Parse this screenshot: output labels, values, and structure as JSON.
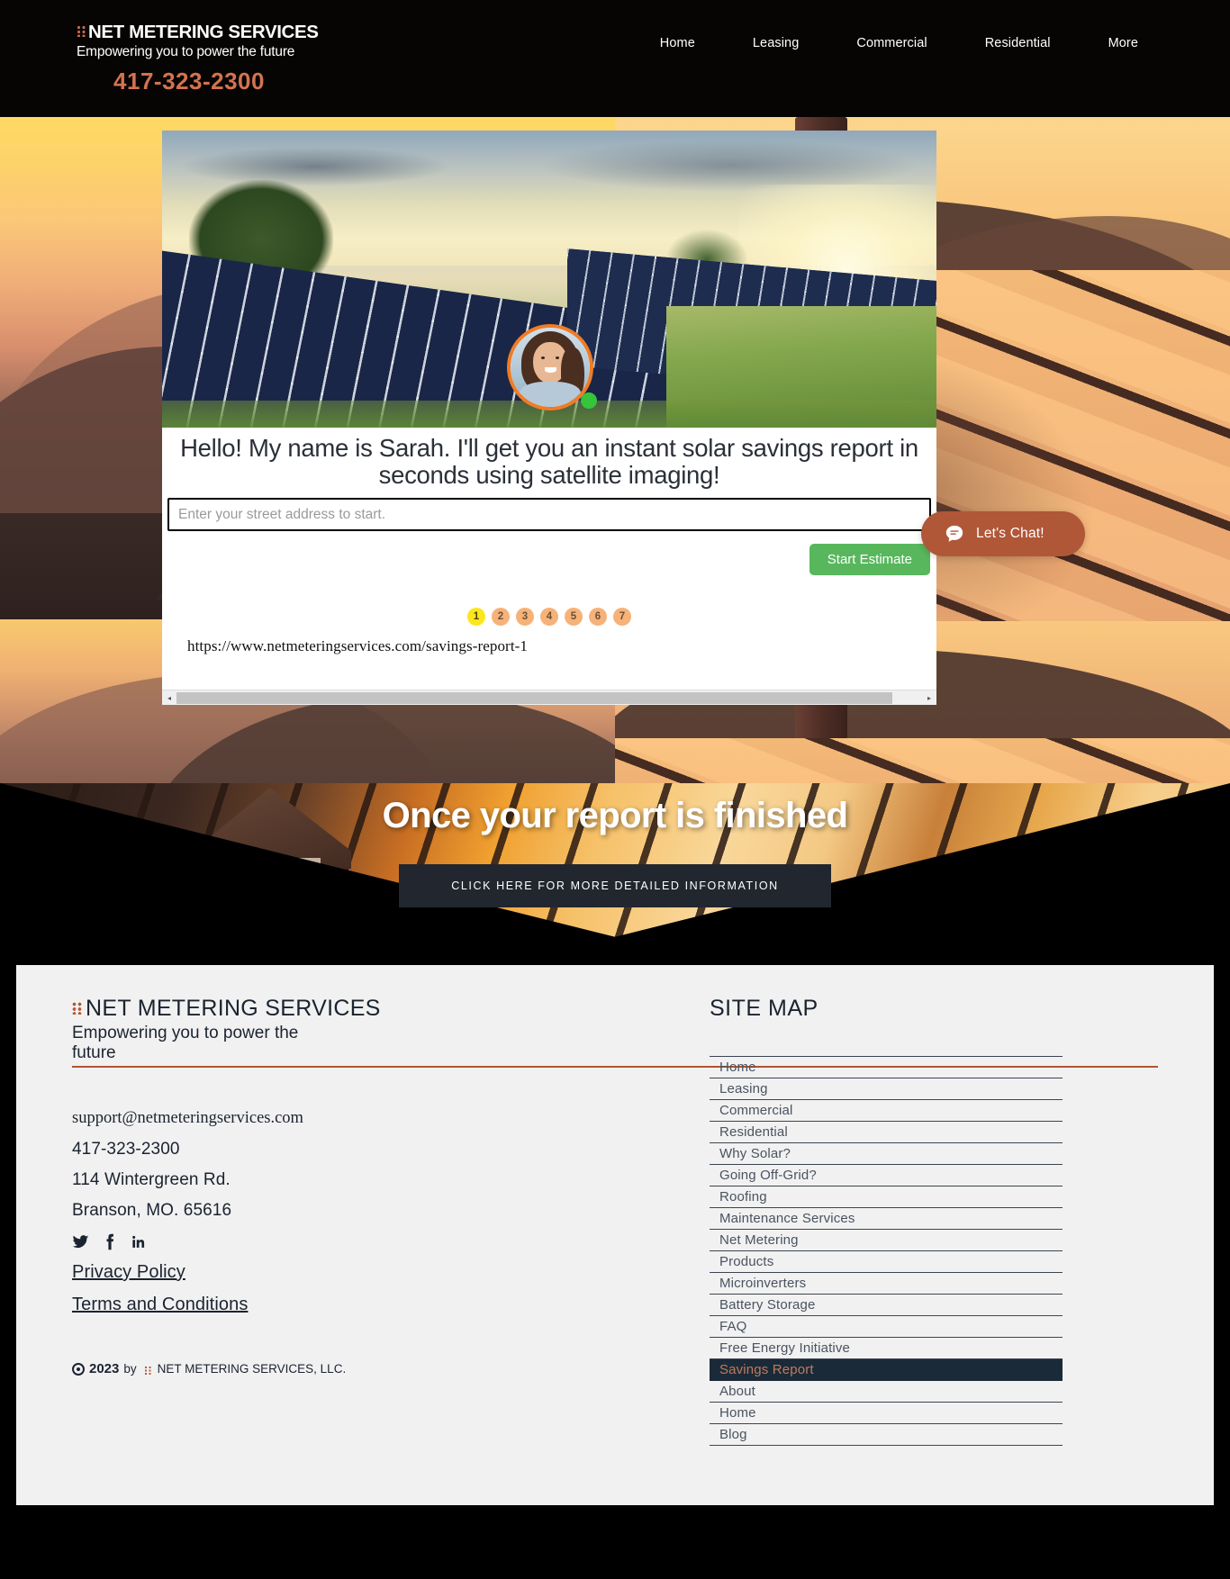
{
  "header": {
    "logo": {
      "name": "NET METERING SERVICES",
      "tagline": "Empowering you to power the future",
      "phone": "417-323-2300",
      "dots_icon": "brand-dots-icon"
    },
    "nav": [
      {
        "label": "Home"
      },
      {
        "label": "Leasing"
      },
      {
        "label": "Commercial"
      },
      {
        "label": "Residential"
      },
      {
        "label": "More"
      }
    ],
    "background_color": "#070404",
    "phone_color": "#d4734f"
  },
  "widget": {
    "photo_alt": "solar-panel-field-photo",
    "avatar": {
      "name": "avatar",
      "status": "online",
      "status_color": "#35c43a",
      "ring_color": "#ef7c27"
    },
    "headline": "Hello! My name is Sarah. I'll get you an instant solar savings report in seconds using satellite imaging!",
    "address_input": {
      "value": "",
      "placeholder": "Enter your street address to start."
    },
    "start_button": {
      "label": "Start Estimate",
      "color": "#58b75c"
    },
    "steps": [
      {
        "label": "1",
        "active": true
      },
      {
        "label": "2",
        "active": false
      },
      {
        "label": "3",
        "active": false
      },
      {
        "label": "4",
        "active": false
      },
      {
        "label": "5",
        "active": false
      },
      {
        "label": "6",
        "active": false
      },
      {
        "label": "7",
        "active": false
      }
    ],
    "step_active_color": "#fbe61f",
    "step_color": "#f6b278",
    "url": "https://www.netmeteringservices.com/savings-report-1",
    "scrollbar": {
      "left_arrow": "◂",
      "right_arrow": "▸"
    }
  },
  "chat": {
    "label": "Let's Chat!",
    "icon": "chat-bubble-icon",
    "color": "#b05738"
  },
  "report_section": {
    "title": "Once your report is finished",
    "cta_label": "CLICK HERE FOR MORE DETAILED INFORMATION",
    "cta_color": "#22262f"
  },
  "footer": {
    "logo": {
      "name": "NET METERING SERVICES",
      "tagline": "Empowering you to power the future"
    },
    "rule_color": "#b1542f",
    "email": "support@netmeteringservices.com",
    "phone": "417-323-2300",
    "address_line1": "114 Wintergreen Rd.",
    "address_line2": "Branson, MO. 65616",
    "social": [
      {
        "name": "twitter-icon"
      },
      {
        "name": "facebook-icon"
      },
      {
        "name": "linkedin-icon"
      }
    ],
    "links": [
      {
        "label": "Privacy Policy"
      },
      {
        "label": "Terms and Conditions"
      }
    ],
    "copyright": {
      "year": "2023",
      "by": "by",
      "company": "NET METERING SERVICES, LLC."
    },
    "sitemap": {
      "title": "SITE MAP",
      "items": [
        {
          "label": "Home",
          "active": false
        },
        {
          "label": "Leasing",
          "active": false
        },
        {
          "label": "Commercial",
          "active": false
        },
        {
          "label": "Residential",
          "active": false
        },
        {
          "label": "Why Solar?",
          "active": false
        },
        {
          "label": "Going Off-Grid?",
          "active": false
        },
        {
          "label": "Roofing",
          "active": false
        },
        {
          "label": "Maintenance Services",
          "active": false
        },
        {
          "label": "Net Metering",
          "active": false
        },
        {
          "label": "Products",
          "active": false
        },
        {
          "label": "Microinverters",
          "active": false
        },
        {
          "label": "Battery Storage",
          "active": false
        },
        {
          "label": "FAQ",
          "active": false
        },
        {
          "label": "Free Energy Initiative",
          "active": false
        },
        {
          "label": "Savings Report",
          "active": true
        },
        {
          "label": "About",
          "active": false
        },
        {
          "label": "Home",
          "active": false
        },
        {
          "label": "Blog",
          "active": false
        }
      ],
      "active_bg": "#1b2a38",
      "active_color": "#c07a5d"
    }
  }
}
